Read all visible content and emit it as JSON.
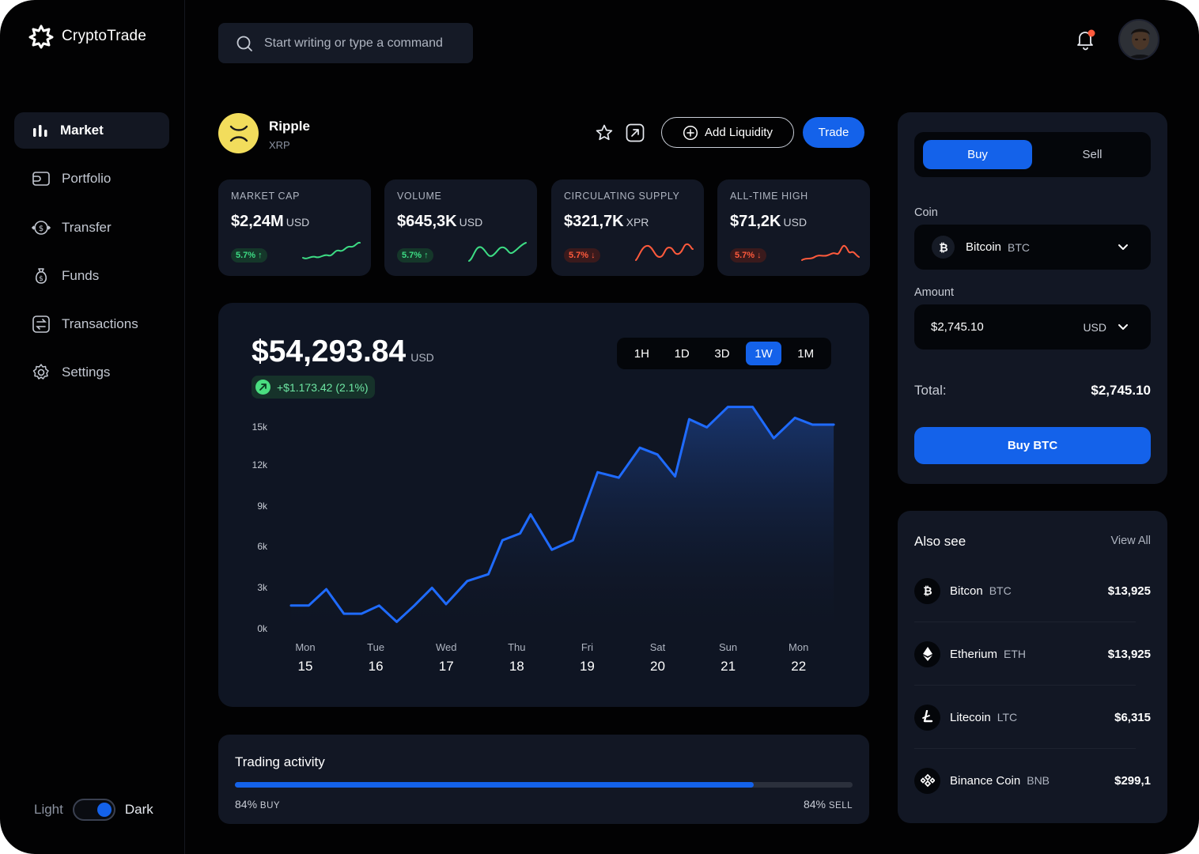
{
  "app": {
    "name": "CryptoTrade"
  },
  "sidebar": {
    "items": [
      {
        "label": "Market",
        "icon": "bar-chart-icon",
        "active": true
      },
      {
        "label": "Portfolio",
        "icon": "wallet-icon",
        "active": false
      },
      {
        "label": "Transfer",
        "icon": "transfer-icon",
        "active": false
      },
      {
        "label": "Funds",
        "icon": "money-bag-icon",
        "active": false
      },
      {
        "label": "Transactions",
        "icon": "exchange-icon",
        "active": false
      },
      {
        "label": "Settings",
        "icon": "gear-icon",
        "active": false
      }
    ],
    "theme": {
      "light_label": "Light",
      "dark_label": "Dark",
      "selected": "Dark"
    }
  },
  "topbar": {
    "search_placeholder": "Start writing or type a command",
    "has_notification": true
  },
  "coin": {
    "name": "Ripple",
    "symbol": "XRP",
    "add_liquidity_label": "Add Liquidity",
    "trade_label": "Trade"
  },
  "stats": [
    {
      "label": "MARKET CAP",
      "value": "$2,24M",
      "unit": "USD",
      "change": "5.7%",
      "direction": "up"
    },
    {
      "label": "VOLUME",
      "value": "$645,3K",
      "unit": "USD",
      "change": "5.7%",
      "direction": "up"
    },
    {
      "label": "CIRCULATING SUPPLY",
      "value": "$321,7K",
      "unit": "XPR",
      "change": "5.7%",
      "direction": "down"
    },
    {
      "label": "ALL-TIME HIGH",
      "value": "$71,2K",
      "unit": "USD",
      "change": "5.7%",
      "direction": "down"
    }
  ],
  "price_card": {
    "price": "$54,293.84",
    "unit": "USD",
    "change": "+$1.173.42 (2.1%)",
    "ranges": [
      "1H",
      "1D",
      "3D",
      "1W",
      "1M"
    ],
    "active_range": "1W"
  },
  "chart_data": {
    "type": "area",
    "y_ticks": [
      "15k",
      "12k",
      "9k",
      "6k",
      "3k",
      "0k"
    ],
    "ylim": [
      0,
      15000
    ],
    "x_labels": [
      {
        "day": "Mon",
        "date": "15"
      },
      {
        "day": "Tue",
        "date": "16"
      },
      {
        "day": "Wed",
        "date": "17"
      },
      {
        "day": "Thu",
        "date": "18"
      },
      {
        "day": "Fri",
        "date": "19"
      },
      {
        "day": "Sat",
        "date": "20"
      },
      {
        "day": "Sun",
        "date": "21"
      },
      {
        "day": "Mon",
        "date": "22"
      }
    ],
    "series": [
      {
        "x": [
          0,
          0.25,
          0.5,
          0.75,
          1,
          1.25,
          1.5,
          1.75,
          2,
          2.2,
          2.5,
          2.8,
          3,
          3.25,
          3.4,
          3.7,
          4,
          4.35,
          4.65,
          4.95,
          5.2,
          5.45,
          5.65,
          5.9,
          6.2,
          6.55,
          6.85,
          7.15,
          7.4,
          7.7
        ],
        "y": [
          1700,
          1700,
          2900,
          1100,
          1100,
          1700,
          500,
          1700,
          3000,
          1800,
          3500,
          4000,
          6500,
          7000,
          8400,
          5800,
          6500,
          11500,
          11100,
          13300,
          12800,
          11200,
          15400,
          14800,
          16300,
          16300,
          14000,
          15500,
          15000,
          15000
        ]
      }
    ]
  },
  "activity": {
    "title": "Trading activity",
    "buy_percent": 84,
    "left_value": "84%",
    "left_label": "BUY",
    "right_value": "84%",
    "right_label": "SELL"
  },
  "trade_panel": {
    "buy_label": "Buy",
    "sell_label": "Sell",
    "coin_label": "Coin",
    "coin_name": "Bitcoin",
    "coin_symbol": "BTC",
    "amount_label": "Amount",
    "amount_value": "$2,745.10",
    "currency": "USD",
    "total_label": "Total:",
    "total_value": "$2,745.10",
    "submit_label": "Buy BTC"
  },
  "also_see": {
    "title": "Also see",
    "view_all": "View All",
    "items": [
      {
        "name": "Bitcon",
        "symbol": "BTC",
        "price": "$13,925",
        "icon": "bitcoin-icon"
      },
      {
        "name": "Etherium",
        "symbol": "ETH",
        "price": "$13,925",
        "icon": "ethereum-icon"
      },
      {
        "name": "Litecoin",
        "symbol": "LTC",
        "price": "$6,315",
        "icon": "litecoin-icon"
      },
      {
        "name": "Binance Coin",
        "symbol": "BNB",
        "price": "$299,1",
        "icon": "binance-icon"
      }
    ]
  },
  "colors": {
    "accent": "#1462ea",
    "up": "#3ddc84",
    "down": "#ff5a3c",
    "ripple": "#f2dd5c"
  }
}
